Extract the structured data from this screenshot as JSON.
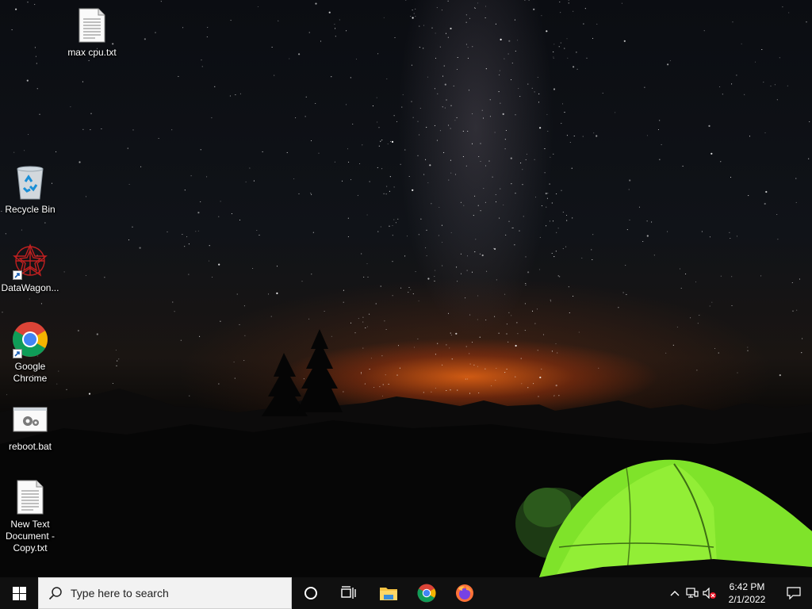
{
  "desktop": {
    "icons": [
      {
        "id": "max-cpu",
        "label": "max cpu.txt",
        "icon": "text-file-icon"
      },
      {
        "id": "recycle-bin",
        "label": "Recycle Bin",
        "icon": "recycle-bin-icon"
      },
      {
        "id": "datawagon",
        "label": "DataWagon...",
        "icon": "datawagon-icon",
        "shortcut": true
      },
      {
        "id": "chrome",
        "label": "Google Chrome",
        "icon": "chrome-icon",
        "shortcut": true
      },
      {
        "id": "reboot",
        "label": "reboot.bat",
        "icon": "batch-file-icon"
      },
      {
        "id": "new-text",
        "label": "New Text Document - Copy.txt",
        "icon": "text-file-icon"
      }
    ]
  },
  "taskbar": {
    "search_placeholder": "Type here to search",
    "pinned": [
      "cortana-icon",
      "task-view-icon",
      "file-explorer-icon",
      "chrome-icon",
      "firefox-icon"
    ],
    "tray": {
      "time": "6:42 PM",
      "date": "2/1/2022"
    }
  },
  "colors": {
    "taskbar": "#101010",
    "search_box": "#f2f2f2",
    "tent_green": "#7fe32a"
  }
}
